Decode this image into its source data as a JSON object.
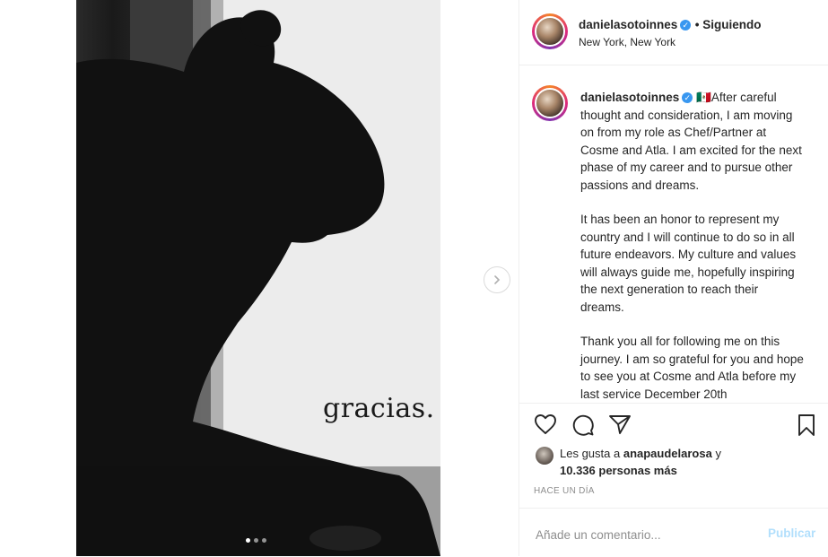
{
  "post": {
    "username": "danielasotoinnes",
    "verified_icon": "verified-check-icon",
    "follow_status": "• Siguiendo",
    "location": "New York, New York",
    "photo_caption": "gracias.",
    "carousel": {
      "total": 3,
      "active": 1
    }
  },
  "caption": {
    "username": "danielasotoinnes",
    "first_line": "🇲🇽After careful thought and consideration, I am moving on from my role as Chef/Partner at Cosme and Atla. I am excited for the next phase of my career and to pursue other passions and dreams.",
    "paragraph2": "It has been an honor to represent my country and I will continue to do so in all future endeavors. My culture and values will always guide me, hopefully inspiring the next generation to reach their dreams.",
    "paragraph3": "Thank you all for following me on this journey. I am so grateful for you and hope to see you at Cosme and Atla before my last service December 20th"
  },
  "actions": {
    "icons": [
      "heart-icon",
      "comment-icon",
      "share-icon",
      "bookmark-icon"
    ],
    "likes_prefix": "Les gusta a",
    "likes_user": "anapaudelarosa",
    "likes_joiner": "y",
    "likes_count": "10.336 personas más",
    "timestamp": "HACE UN DÍA"
  },
  "comment": {
    "placeholder": "Añade un comentario...",
    "publish_label": "Publicar"
  },
  "colors": {
    "accent_blue": "#3897f0",
    "publish_disabled": "#b2dffc",
    "text": "#262626",
    "muted": "#8e8e8e"
  }
}
